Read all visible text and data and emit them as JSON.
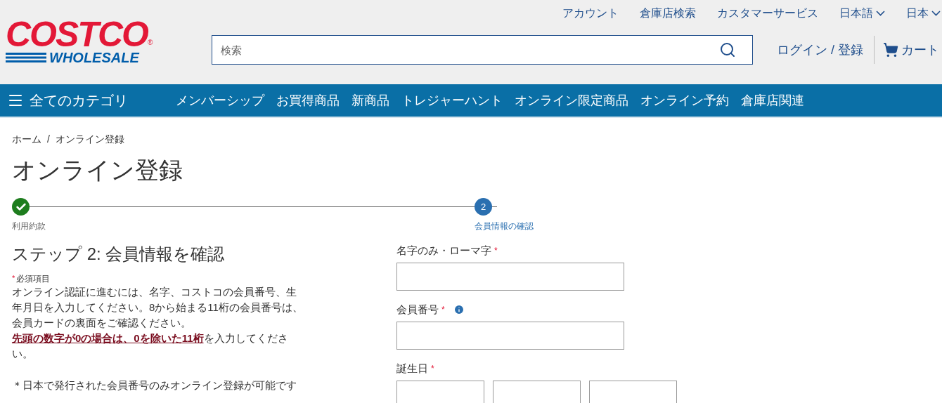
{
  "header": {
    "logo": {
      "top": "COSTCO",
      "bottom": "WHOLESALE",
      "mark": "®"
    },
    "utility_links": [
      {
        "label": "アカウント",
        "dropdown": false
      },
      {
        "label": "倉庫店検索",
        "dropdown": false
      },
      {
        "label": "カスタマーサービス",
        "dropdown": false
      },
      {
        "label": "日本語",
        "dropdown": true
      },
      {
        "label": "日本",
        "dropdown": true
      }
    ],
    "search": {
      "placeholder": "検索"
    },
    "login": "ログイン / 登録",
    "cart": "カート"
  },
  "nav": {
    "all_categories": "全てのカテゴリ",
    "items": [
      "メンバーシップ",
      "お買得商品",
      "新商品",
      "トレジャーハント",
      "オンライン限定商品",
      "オンライン予約",
      "倉庫店関連"
    ]
  },
  "breadcrumb": [
    "ホーム",
    "/",
    "オンライン登録"
  ],
  "title": "オンライン登録",
  "stepper": [
    {
      "label": "利用約款",
      "done": true,
      "selected": false
    },
    {
      "label": "会員情報の確認",
      "number": "2",
      "done": false,
      "selected": true
    }
  ],
  "step_heading": "ステップ 2: 会員情報を確認",
  "required_note": {
    "mark": "*",
    "text": "必須項目"
  },
  "instructions": "オンライン認証に進むには、名字、コストコの会員番号、生年月日を入力してください。8から始まる11桁の会員番号は、会員カードの裏面をご確認ください。",
  "instructions_link": "先頭の数字が0の場合は、0を除いた11桁",
  "instructions_end": "を入力してください。",
  "note": "＊日本で発行された会員番号のみオンライン登録が可能です",
  "form": {
    "fields": [
      {
        "label": "名字のみ・ローマ字",
        "required": true,
        "info": false,
        "kind": "text"
      },
      {
        "label": "会員番号",
        "required": true,
        "info": true,
        "kind": "text"
      },
      {
        "label": "誕生日",
        "required": true,
        "info": false,
        "kind": "date"
      }
    ]
  }
}
